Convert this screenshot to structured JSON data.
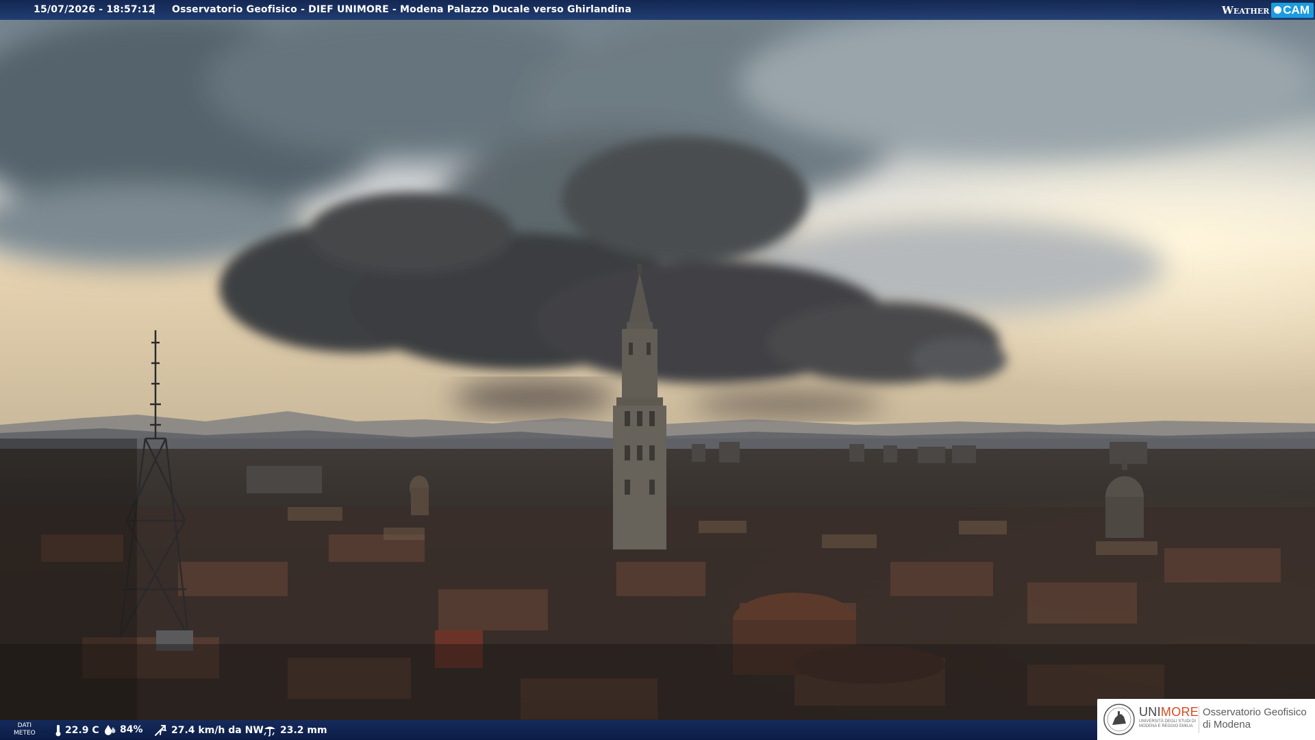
{
  "overlay": {
    "timestamp": "15/07/2026 - 18:57:12",
    "separator": "|",
    "title": "Osservatorio Geofisico - DIEF UNIMORE - Modena Palazzo Ducale verso Ghirlandina",
    "brand_weather": "Weather",
    "brand_cam": "CAM"
  },
  "meteo": {
    "label_line1": "DATI",
    "label_line2": "METEO",
    "temperature": "22.9 C",
    "humidity": "84%",
    "wind": "27.4 km/h da NW",
    "rain": "23.2 mm"
  },
  "logo": {
    "uni_part1": "UNI",
    "uni_part2": "MORE",
    "uni_sub_line1": "UNIVERSITÀ DEGLI STUDI DI",
    "uni_sub_line2": "MODENA E REGGIO EMILIA",
    "obs_line1": "Osservatorio Geofisico",
    "obs_line2": "di Modena"
  },
  "colors": {
    "bar_blue": "#12306e",
    "cam_accent": "#1c9be0",
    "more_accent": "#d94820"
  },
  "icons": [
    "thermometer-icon",
    "humidity-drop-icon",
    "wind-icon",
    "rain-gauge-icon",
    "camera-dot-icon",
    "university-seal-icon"
  ]
}
